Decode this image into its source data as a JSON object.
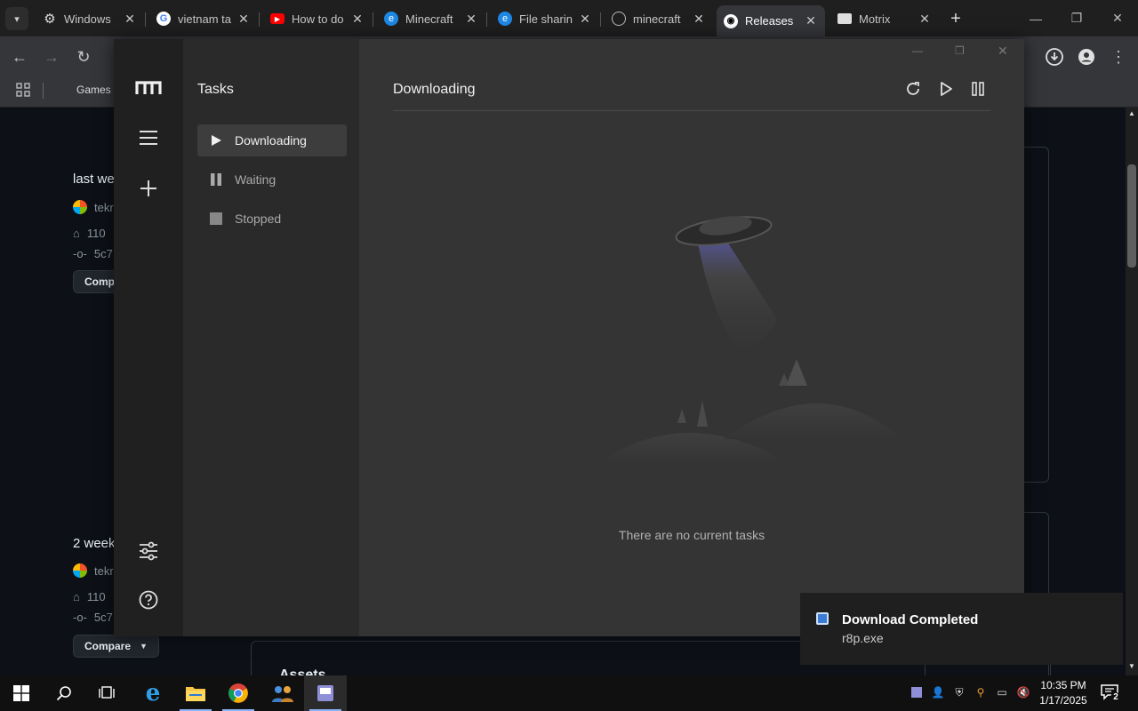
{
  "tabs": [
    {
      "title": "Windows",
      "icon": "gear-icon"
    },
    {
      "title": "vietnam ta",
      "icon": "google-icon"
    },
    {
      "title": "How to do",
      "icon": "youtube-icon"
    },
    {
      "title": "Minecraft",
      "icon": "edge-icon"
    },
    {
      "title": "File sharin",
      "icon": "edge-icon"
    },
    {
      "title": "minecraft",
      "icon": "globe-icon"
    },
    {
      "title": "Releases",
      "icon": "github-icon"
    },
    {
      "title": "Motrix",
      "icon": "motrix-icon"
    }
  ],
  "bookmarks": {
    "games": "Games"
  },
  "github": {
    "release1": {
      "when": "last we",
      "author": "tekr",
      "tag": "110",
      "commit": "5c7",
      "compare": "Comp"
    },
    "release2": {
      "when": "2 week",
      "author": "tekr",
      "tag": "110",
      "commit": "5c7",
      "compare": "Compare"
    },
    "assets": "Assets"
  },
  "motrix": {
    "sidebar_title": "Tasks",
    "items": [
      {
        "label": "Downloading"
      },
      {
        "label": "Waiting"
      },
      {
        "label": "Stopped"
      }
    ],
    "main_title": "Downloading",
    "empty_text": "There are no current tasks"
  },
  "toast": {
    "title": "Download Completed",
    "file": "r8p.exe"
  },
  "clock": {
    "time": "10:35 PM",
    "date": "1/17/2025"
  },
  "notification_count": "2",
  "colors": {
    "accent": "#8ab4f8",
    "motrix_bg": "#343434",
    "sidebar_bg": "#2a2a2a"
  }
}
